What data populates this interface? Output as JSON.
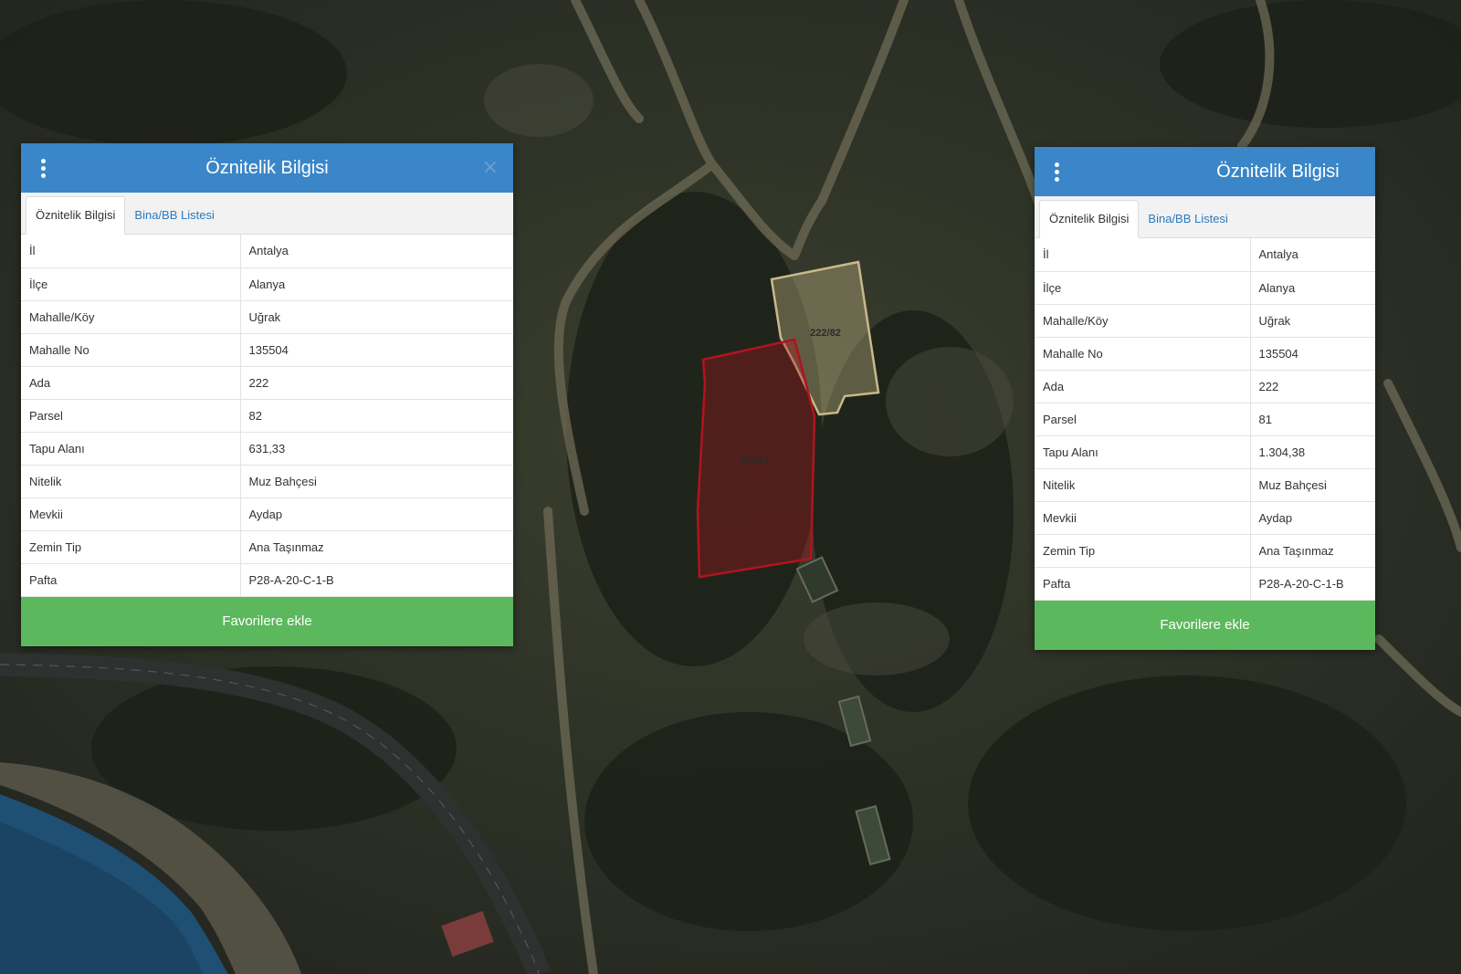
{
  "map": {
    "parcel_labels": {
      "parcel_82": "222/82",
      "parcel_81": "222/81"
    },
    "colors": {
      "parcel_82_stroke": "#c9b98a",
      "parcel_81_stroke": "#b0141e",
      "road": "#3a3a3a",
      "sea": "#1f4f73"
    }
  },
  "panels": [
    {
      "title": "Öznitelik Bilgisi",
      "menu_icon": "kebab-menu-icon",
      "close_icon": "×",
      "tabs": [
        {
          "label": "Öznitelik Bilgisi",
          "active": true
        },
        {
          "label": "Bina/BB Listesi",
          "active": false
        }
      ],
      "rows": [
        {
          "key": "İl",
          "value": "Antalya"
        },
        {
          "key": "İlçe",
          "value": "Alanya"
        },
        {
          "key": "Mahalle/Köy",
          "value": "Uğrak"
        },
        {
          "key": "Mahalle No",
          "value": "135504"
        },
        {
          "key": "Ada",
          "value": "222"
        },
        {
          "key": "Parsel",
          "value": "82"
        },
        {
          "key": "Tapu Alanı",
          "value": "631,33"
        },
        {
          "key": "Nitelik",
          "value": "Muz Bahçesi"
        },
        {
          "key": "Mevkii",
          "value": "Aydap"
        },
        {
          "key": "Zemin Tip",
          "value": "Ana Taşınmaz"
        },
        {
          "key": "Pafta",
          "value": "P28-A-20-C-1-B"
        }
      ],
      "button_label": "Favorilere ekle"
    },
    {
      "title": "Öznitelik Bilgisi",
      "menu_icon": "kebab-menu-icon",
      "tabs": [
        {
          "label": "Öznitelik Bilgisi",
          "active": true
        },
        {
          "label": "Bina/BB Listesi",
          "active": false
        }
      ],
      "rows": [
        {
          "key": "İl",
          "value": "Antalya"
        },
        {
          "key": "İlçe",
          "value": "Alanya"
        },
        {
          "key": "Mahalle/Köy",
          "value": "Uğrak"
        },
        {
          "key": "Mahalle No",
          "value": "135504"
        },
        {
          "key": "Ada",
          "value": "222"
        },
        {
          "key": "Parsel",
          "value": "81"
        },
        {
          "key": "Tapu Alanı",
          "value": "1.304,38"
        },
        {
          "key": "Nitelik",
          "value": "Muz Bahçesi"
        },
        {
          "key": "Mevkii",
          "value": "Aydap"
        },
        {
          "key": "Zemin Tip",
          "value": "Ana Taşınmaz"
        },
        {
          "key": "Pafta",
          "value": "P28-A-20-C-1-B"
        }
      ],
      "button_label": "Favorilere ekle"
    }
  ]
}
